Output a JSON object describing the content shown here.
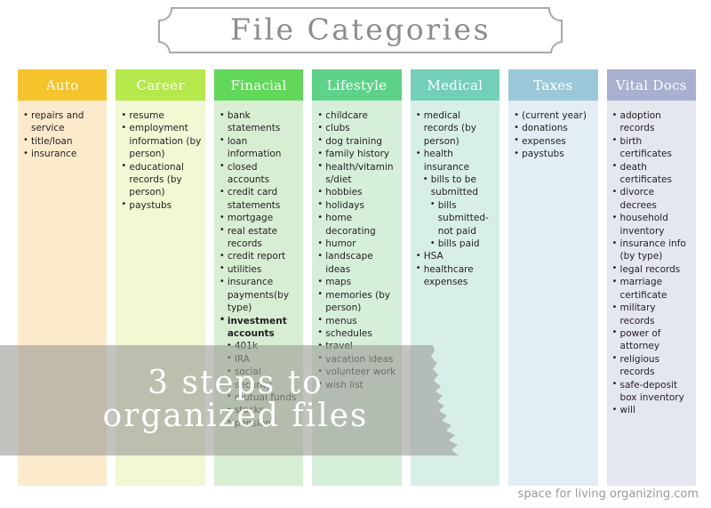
{
  "header": {
    "title": "File Categories"
  },
  "overlay": {
    "line1": "3 steps to",
    "line2": "organized files",
    "color": "#9c9c96"
  },
  "footer": {
    "credit": "space for living organizing.com"
  },
  "columns": [
    {
      "name": "auto",
      "label": "Auto",
      "header_color": "#f5c32c",
      "body_color": "#fbeacc",
      "items": [
        {
          "text": "repairs and service"
        },
        {
          "text": "title/loan"
        },
        {
          "text": "insurance"
        }
      ]
    },
    {
      "name": "career",
      "label": "Career",
      "header_color": "#b4e84b",
      "body_color": "#f0f8d4",
      "items": [
        {
          "text": "resume"
        },
        {
          "text": "employment information (by person)"
        },
        {
          "text": "educational records (by person)"
        },
        {
          "text": "paystubs"
        }
      ]
    },
    {
      "name": "finacial",
      "label": "Finacial",
      "header_color": "#62d85a",
      "body_color": "#d8eed3",
      "items": [
        {
          "text": "bank statements"
        },
        {
          "text": "loan information"
        },
        {
          "text": "closed accounts"
        },
        {
          "text": "credit card statements"
        },
        {
          "text": "mortgage"
        },
        {
          "text": "real estate records"
        },
        {
          "text": "credit report"
        },
        {
          "text": "utilities"
        },
        {
          "text": "insurance payments(by type)"
        },
        {
          "text": "investment accounts",
          "bold": true,
          "children": [
            {
              "text": "401k"
            },
            {
              "text": "IRA"
            },
            {
              "text": "social security"
            },
            {
              "text": "mutual funds"
            },
            {
              "text": "stocks"
            },
            {
              "text": "pension"
            }
          ]
        }
      ]
    },
    {
      "name": "lifestyle",
      "label": "Lifestyle",
      "header_color": "#5fd28a",
      "body_color": "#d6efda",
      "items": [
        {
          "text": "childcare"
        },
        {
          "text": "clubs"
        },
        {
          "text": "dog training"
        },
        {
          "text": "family history"
        },
        {
          "text": "health/vitamins/diet"
        },
        {
          "text": "hobbies"
        },
        {
          "text": "holidays"
        },
        {
          "text": "home decorating"
        },
        {
          "text": "humor"
        },
        {
          "text": "landscape ideas"
        },
        {
          "text": "maps"
        },
        {
          "text": "memories (by person)"
        },
        {
          "text": "menus"
        },
        {
          "text": "schedules"
        },
        {
          "text": "travel"
        },
        {
          "text": "vacation ideas"
        },
        {
          "text": "volunteer work"
        },
        {
          "text": "wish list"
        }
      ]
    },
    {
      "name": "medical",
      "label": "Medical",
      "header_color": "#74cfb8",
      "body_color": "#d8efe9",
      "items": [
        {
          "text": "medical records (by person)"
        },
        {
          "text": "health insurance",
          "children": [
            {
              "text": "bills to be submitted",
              "children": [
                {
                  "text": "bills submitted-not paid"
                },
                {
                  "text": "bills paid"
                }
              ]
            }
          ]
        },
        {
          "text": "HSA"
        },
        {
          "text": "healthcare expenses"
        }
      ]
    },
    {
      "name": "taxes",
      "label": "Taxes",
      "header_color": "#9bc8d8",
      "body_color": "#e2edf4",
      "items": [
        {
          "text": "(current year)"
        },
        {
          "text": "donations"
        },
        {
          "text": "expenses"
        },
        {
          "text": "paystubs"
        }
      ]
    },
    {
      "name": "vital-docs",
      "label": "Vital Docs",
      "header_color": "#a9afcf",
      "body_color": "#e4e6f0",
      "items": [
        {
          "text": "adoption records"
        },
        {
          "text": "birth certificates"
        },
        {
          "text": "death certificates"
        },
        {
          "text": "divorce decrees"
        },
        {
          "text": "household inventory"
        },
        {
          "text": "insurance info (by type)"
        },
        {
          "text": "legal records"
        },
        {
          "text": "marriage certificate"
        },
        {
          "text": "military records"
        },
        {
          "text": "power of attorney"
        },
        {
          "text": "religious records"
        },
        {
          "text": "safe-deposit box inventory"
        },
        {
          "text": "will"
        }
      ]
    }
  ]
}
